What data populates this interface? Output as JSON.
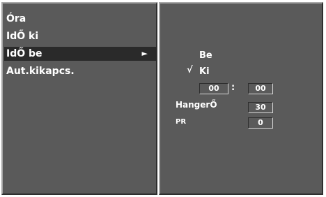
{
  "menu": {
    "items": [
      {
        "label": "Óra"
      },
      {
        "label": "IdŐ ki"
      },
      {
        "label": "IdŐ be",
        "arrow": "►"
      },
      {
        "label": "Aut.kikapcs."
      }
    ],
    "selected_index": 2
  },
  "submenu": {
    "option_on": "Be",
    "check_mark": "√",
    "option_off": "Ki",
    "time": {
      "hours": "00",
      "separator": ":",
      "minutes": "00"
    },
    "volume": {
      "label": "HangerŐ",
      "value": "30"
    },
    "program": {
      "label": "PR",
      "value": "0"
    }
  }
}
